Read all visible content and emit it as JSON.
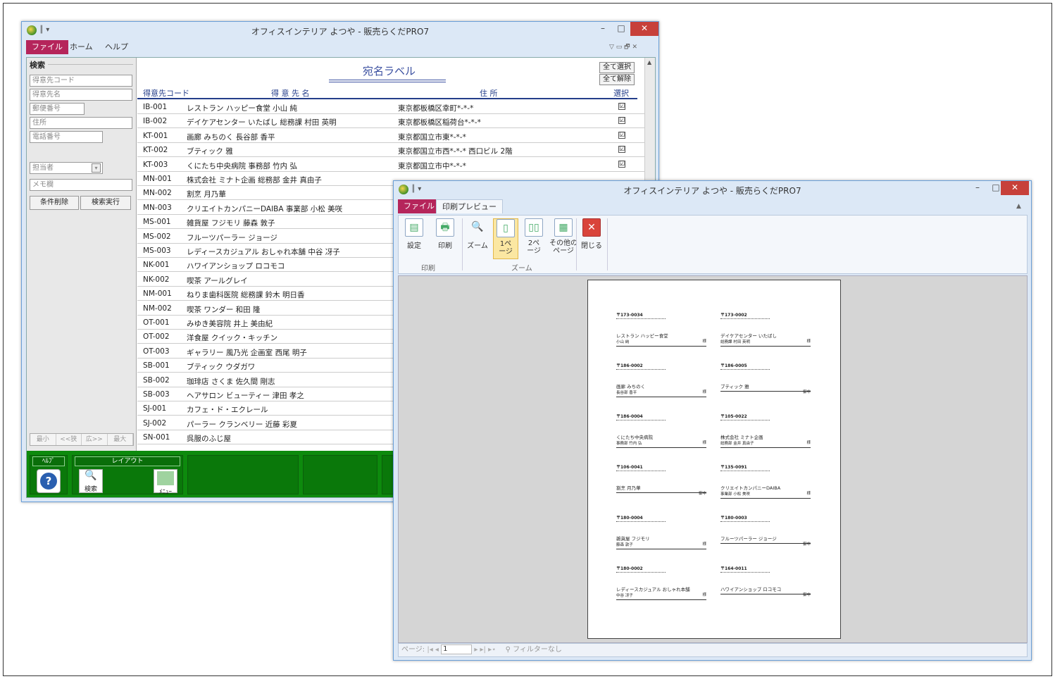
{
  "w1": {
    "title": "オフィスインテリア よつや - 販売らくだPRO7",
    "quick_access": "║ ▾",
    "menu": {
      "file": "ファイル",
      "home": "ホーム",
      "help": "ヘルプ"
    },
    "ribbon_ctrl": "▽ ▭ 🗗 ✕",
    "controls": {
      "minimize": "–",
      "maximize": "□",
      "close": "✕"
    },
    "search": {
      "header": "検索",
      "fields": [
        "得意先コード",
        "得意先名",
        "郵便番号",
        "住所",
        "電話番号"
      ],
      "staff": "担当者",
      "memo": "メモ欄",
      "clear_btn": "条件削除",
      "run_btn": "検索実行",
      "nav": [
        "最小",
        "<<狭",
        "広>>",
        "最大"
      ]
    },
    "report": {
      "title": "宛名ラベル",
      "select_all": "全て選択",
      "deselect_all": "全て解除",
      "columns": {
        "code": "得意先コード",
        "name": "得 意 先 名",
        "addr": "住 所",
        "sel": "選択"
      },
      "rows": [
        {
          "code": "IB-001",
          "name": "レストラン ハッピー食堂 小山 純",
          "addr": "東京都板橋区幸町*-*-*",
          "chk": "☑"
        },
        {
          "code": "IB-002",
          "name": "デイケアセンター いたばし 総務課 村田 英明",
          "addr": "東京都板橋区稲荷台*-*-*",
          "chk": "☑"
        },
        {
          "code": "KT-001",
          "name": "画廊 みちのく 長谷部 香平",
          "addr": "東京都国立市東*-*-*",
          "chk": "☑"
        },
        {
          "code": "KT-002",
          "name": "ブティック 雅",
          "addr": "東京都国立市西*-*-* 西口ビル 2階",
          "chk": "☑"
        },
        {
          "code": "KT-003",
          "name": "くにたち中央病院 事務部 竹内 弘",
          "addr": "東京都国立市中*-*-*",
          "chk": "☑"
        },
        {
          "code": "MN-001",
          "name": "株式会社 ミナト企画 総務部 金井 真由子",
          "addr": "",
          "chk": ""
        },
        {
          "code": "MN-002",
          "name": "割烹 月乃華",
          "addr": "",
          "chk": ""
        },
        {
          "code": "MN-003",
          "name": "クリエイトカンパニーDAIBA 事業部 小松 美咲",
          "addr": "",
          "chk": ""
        },
        {
          "code": "MS-001",
          "name": "雑貨屋 フジモリ 藤森 敦子",
          "addr": "",
          "chk": ""
        },
        {
          "code": "MS-002",
          "name": "フルーツパーラー ジョージ",
          "addr": "",
          "chk": ""
        },
        {
          "code": "MS-003",
          "name": "レディースカジュアル おしゃれ本舗 中谷 冴子",
          "addr": "",
          "chk": ""
        },
        {
          "code": "NK-001",
          "name": "ハワイアンショップ ロコモコ",
          "addr": "",
          "chk": ""
        },
        {
          "code": "NK-002",
          "name": "喫茶 アールグレイ",
          "addr": "",
          "chk": ""
        },
        {
          "code": "NM-001",
          "name": "ねりま歯科医院 総務課 鈴木 明日香",
          "addr": "",
          "chk": ""
        },
        {
          "code": "NM-002",
          "name": "喫茶 ワンダー 和田 隆",
          "addr": "",
          "chk": ""
        },
        {
          "code": "OT-001",
          "name": "みゆき美容院 井上 美由紀",
          "addr": "",
          "chk": ""
        },
        {
          "code": "OT-002",
          "name": "洋食屋 クイック・キッチン",
          "addr": "",
          "chk": ""
        },
        {
          "code": "OT-003",
          "name": "ギャラリー 風乃光 企画室 西尾 明子",
          "addr": "",
          "chk": ""
        },
        {
          "code": "SB-001",
          "name": "ブティック ウダガワ",
          "addr": "",
          "chk": ""
        },
        {
          "code": "SB-002",
          "name": "珈琲店 さくま 佐久間 剛志",
          "addr": "",
          "chk": ""
        },
        {
          "code": "SB-003",
          "name": "ヘアサロン ビューティー 津田 孝之",
          "addr": "",
          "chk": ""
        },
        {
          "code": "SJ-001",
          "name": "カフェ・ド・エクレール",
          "addr": "",
          "chk": ""
        },
        {
          "code": "SJ-002",
          "name": "パーラー クランベリー 近藤 彩夏",
          "addr": "",
          "chk": ""
        },
        {
          "code": "SN-001",
          "name": "呉服のふじ屋",
          "addr": "",
          "chk": ""
        }
      ]
    },
    "footer": {
      "help": "ﾍﾙﾌﾟ",
      "layout": "レイアウト",
      "search_icon": "検索",
      "menu_icon": "ﾒﾆｭｰ"
    }
  },
  "w2": {
    "title": "オフィスインテリア よつや - 販売らくだPRO7",
    "tabs": {
      "file": "ファイル",
      "preview": "印刷プレビュー"
    },
    "buttons": {
      "setup": "設定",
      "print": "印刷",
      "zoom": "ズーム",
      "one_page": "1ペ\nージ",
      "two_page": "2ペ\nージ",
      "other": "その他の\nページ",
      "close": "閉じる"
    },
    "groups": {
      "print": "印刷",
      "zoom": "ズーム"
    },
    "status": {
      "page_label": "ページ:",
      "page_value": "1",
      "filter": "フィルターなし"
    },
    "labels": [
      {
        "zip": "〒173-0034",
        "name": "レストラン ハッピー食堂",
        "person": "小山 純",
        "honor": "様"
      },
      {
        "zip": "〒173-0002",
        "name": "デイケアセンター いたばし",
        "person": "総務課 村田 英明",
        "honor": "様"
      },
      {
        "zip": "〒186-0002",
        "name": "画廊 みちのく",
        "person": "長谷部 香平",
        "honor": "様"
      },
      {
        "zip": "〒186-0005",
        "name": "ブティック 雅",
        "person": "",
        "honor": "御中"
      },
      {
        "zip": "〒186-0004",
        "name": "くにたち中央病院",
        "person": "事務部 竹内 弘",
        "honor": "様"
      },
      {
        "zip": "〒105-0022",
        "name": "株式会社 ミナト企画",
        "person": "総務部 金井 真由子",
        "honor": "様"
      },
      {
        "zip": "〒106-0041",
        "name": "割烹 月乃華",
        "person": "",
        "honor": "御中"
      },
      {
        "zip": "〒135-0091",
        "name": "クリエイトカンパニーDAIBA",
        "person": "事業部 小松 美咲",
        "honor": "様"
      },
      {
        "zip": "〒180-0004",
        "name": "雑貨屋 フジモリ",
        "person": "藤森 敦子",
        "honor": "様"
      },
      {
        "zip": "〒180-0003",
        "name": "フルーツパーラー ジョージ",
        "person": "",
        "honor": "御中"
      },
      {
        "zip": "〒180-0002",
        "name": "レディースカジュアル おしゃれ本舗",
        "person": "中谷 冴子",
        "honor": "様"
      },
      {
        "zip": "〒164-0011",
        "name": "ハワイアンショップ ロコモコ",
        "person": "",
        "honor": "御中"
      }
    ]
  },
  "colors": {
    "file_tab": "#b5255b",
    "footer": "#0d8a0d",
    "title_accent": "#243e8a"
  }
}
